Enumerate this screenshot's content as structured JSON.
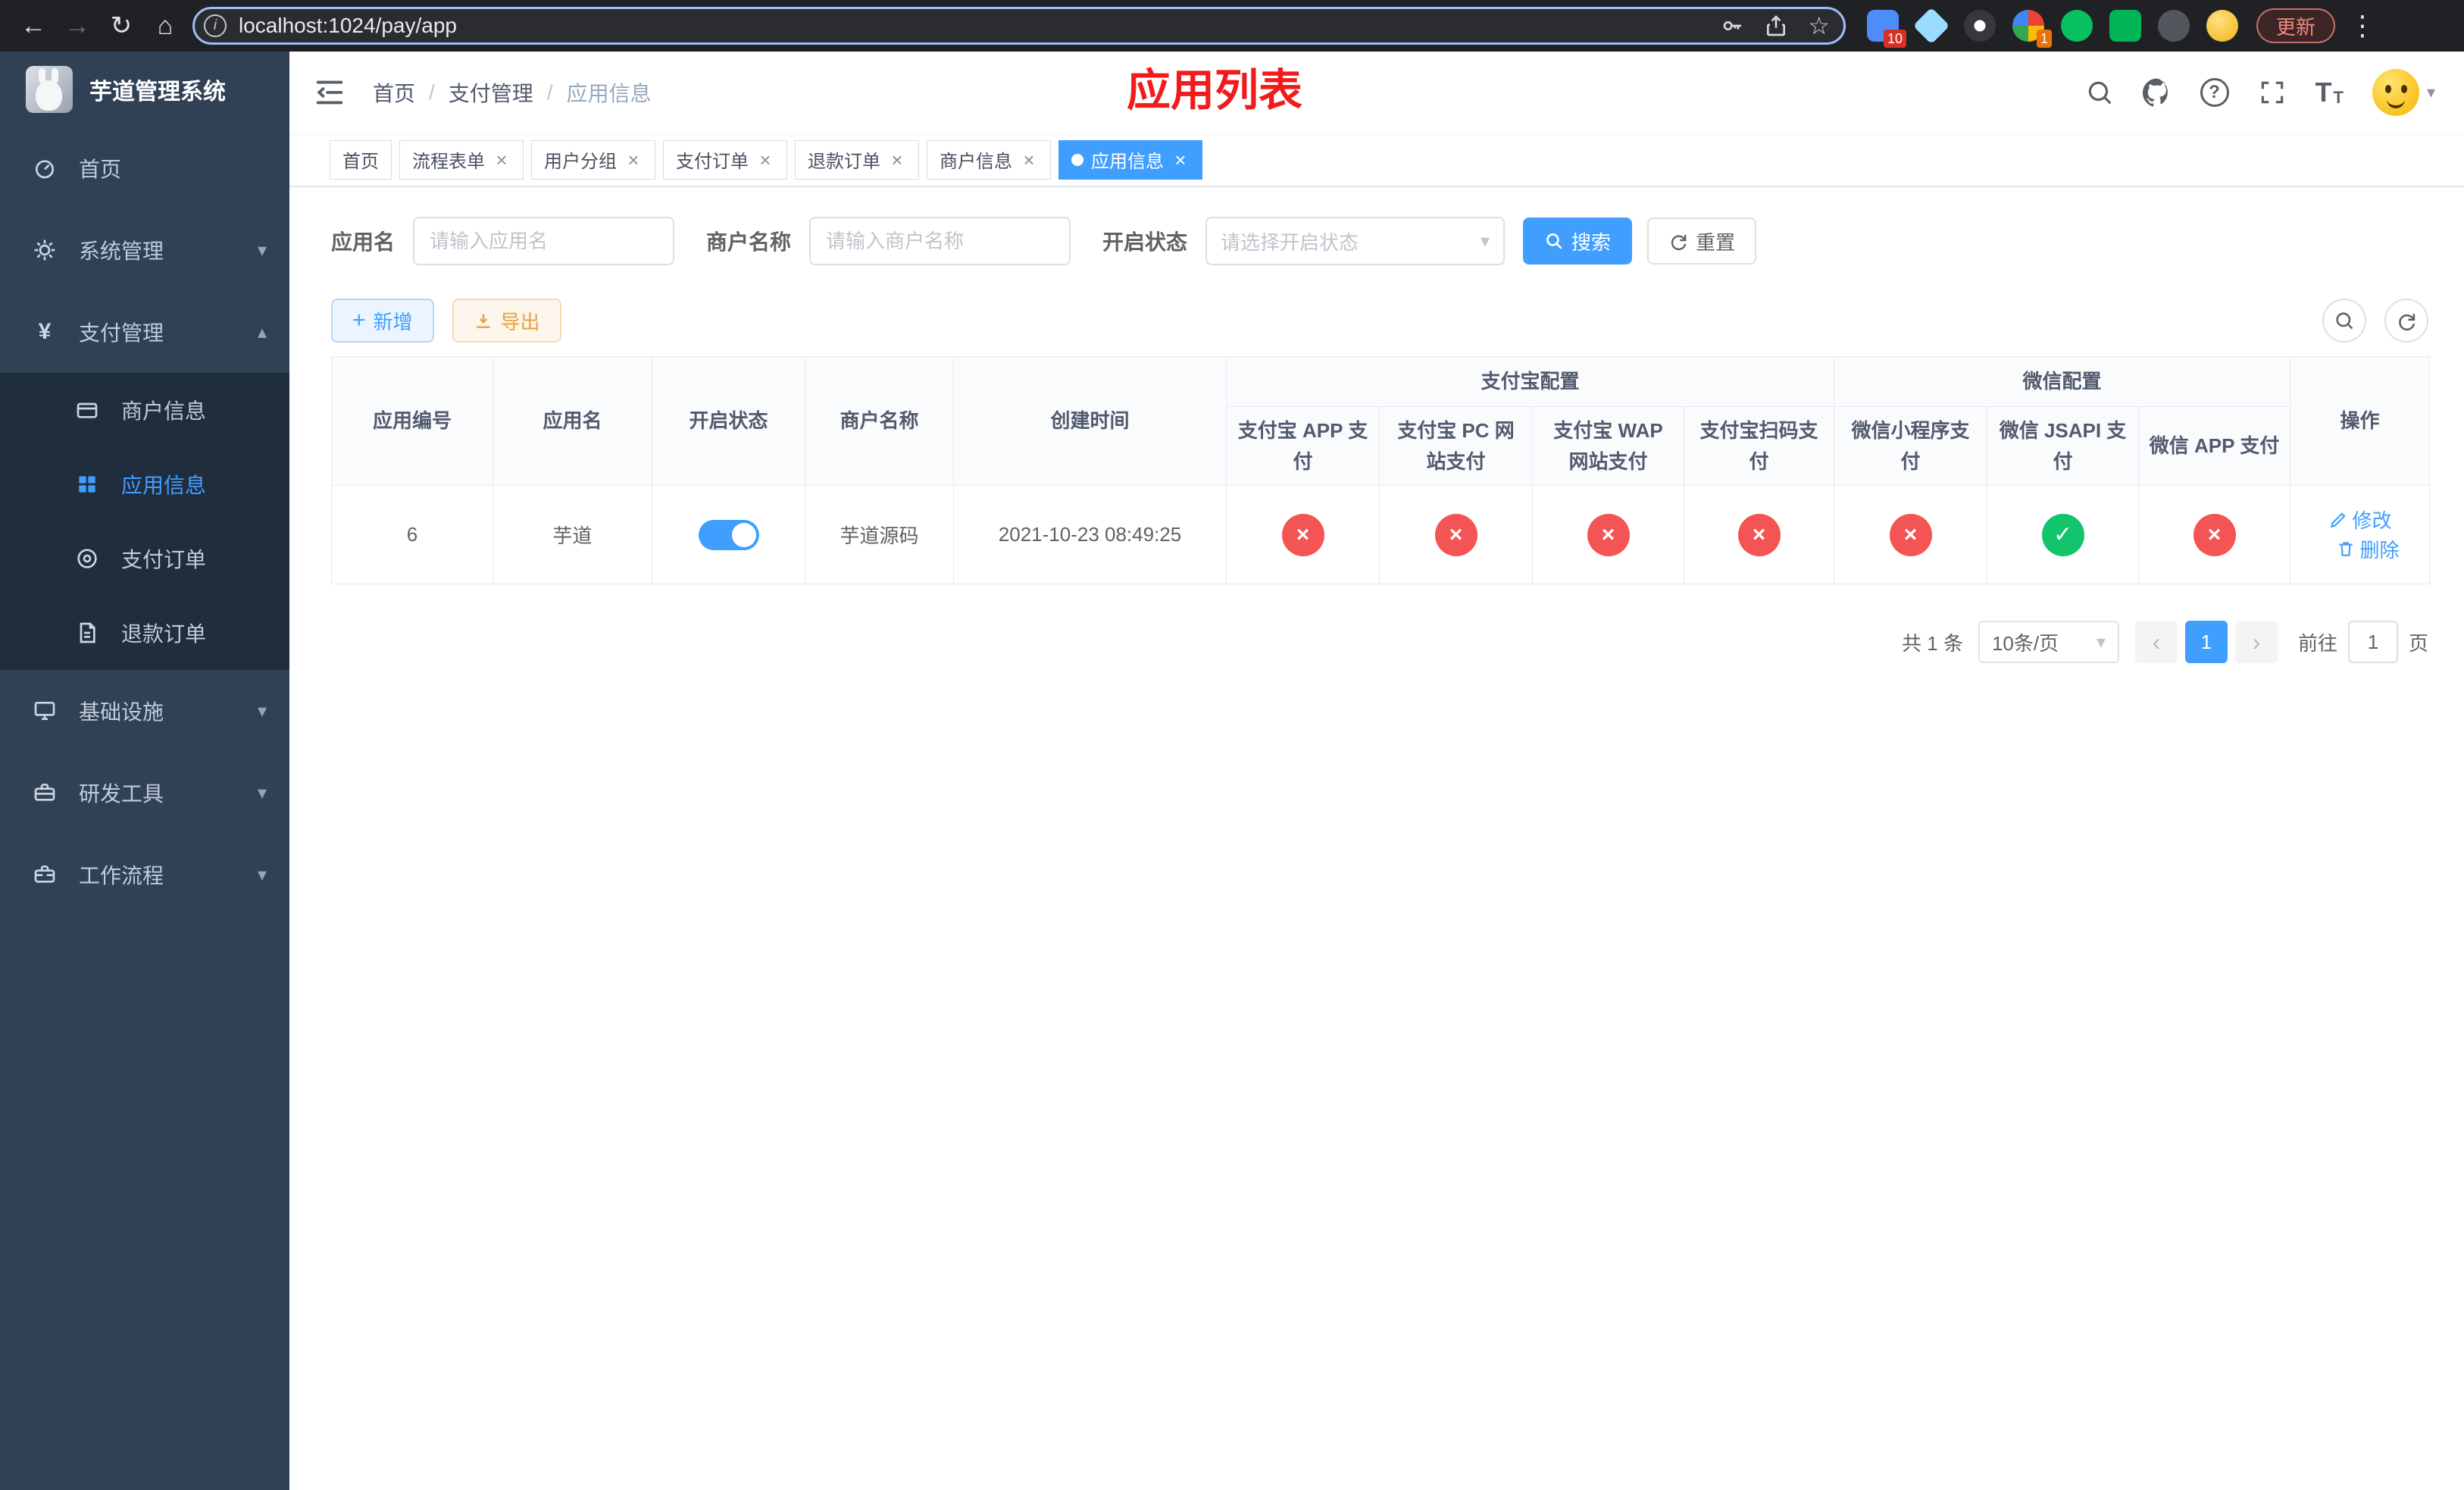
{
  "colors": {
    "primary": "#409eff",
    "success": "#12c56c",
    "danger": "#f45454",
    "warning": "#e6a23c",
    "annotation_red": "#f21b1b",
    "sidebar_bg": "#304156",
    "submenu_bg": "#1f2d3d"
  },
  "icons": {
    "back": "←",
    "forward": "→",
    "reload": "↻",
    "home": "⌂",
    "kebab": "⋮",
    "star": "☆",
    "info": "i",
    "chevron_down": "▾",
    "chevron_up": "▴",
    "close": "×",
    "check": "✓",
    "cross": "×",
    "plus": "+",
    "prev": "‹",
    "next": "›",
    "breadcrumb_sep": "/",
    "help": "?",
    "font_icon": "T"
  },
  "browser": {
    "url": "localhost:1024/pay/app",
    "update_label": "更新",
    "ext_badge_10": "10",
    "ext_badge_1": "1"
  },
  "app": {
    "logo_title": "芋道管理系统",
    "annotation": "应用列表"
  },
  "breadcrumb": [
    "首页",
    "支付管理",
    "应用信息"
  ],
  "sidebar": {
    "items": [
      {
        "label": "首页"
      },
      {
        "label": "系统管理"
      },
      {
        "label": "支付管理"
      },
      {
        "label": "商户信息"
      },
      {
        "label": "应用信息"
      },
      {
        "label": "支付订单"
      },
      {
        "label": "退款订单"
      },
      {
        "label": "基础设施"
      },
      {
        "label": "研发工具"
      },
      {
        "label": "工作流程"
      }
    ]
  },
  "tabs": [
    {
      "label": "首页"
    },
    {
      "label": "流程表单"
    },
    {
      "label": "用户分组"
    },
    {
      "label": "支付订单"
    },
    {
      "label": "退款订单"
    },
    {
      "label": "商户信息"
    },
    {
      "label": "应用信息"
    }
  ],
  "filters": {
    "app_name_label": "应用名",
    "app_name_placeholder": "请输入应用名",
    "merchant_label": "商户名称",
    "merchant_placeholder": "请输入商户名称",
    "status_label": "开启状态",
    "status_placeholder": "请选择开启状态",
    "search_label": "搜索",
    "reset_label": "重置"
  },
  "toolbar": {
    "add_label": "新增",
    "export_label": "导出"
  },
  "table": {
    "groups": {
      "alipay": "支付宝配置",
      "wechat": "微信配置"
    },
    "columns": [
      "应用编号",
      "应用名",
      "开启状态",
      "商户名称",
      "创建时间",
      "支付宝 APP 支付",
      "支付宝 PC 网站支付",
      "支付宝 WAP 网站支付",
      "支付宝扫码支付",
      "微信小程序支付",
      "微信 JSAPI 支付",
      "微信 APP 支付",
      "操作"
    ],
    "rows": [
      {
        "id": "6",
        "name": "芋道",
        "enabled": true,
        "merchant": "芋道源码",
        "created": "2021-10-23 08:49:25",
        "alipay_app": false,
        "alipay_pc": false,
        "alipay_wap": false,
        "alipay_qr": false,
        "wechat_mini": false,
        "wechat_jsapi": true,
        "wechat_app": false
      }
    ],
    "op_edit": "修改",
    "op_delete": "删除"
  },
  "pagination": {
    "total": "共 1 条",
    "page_size": "10条/页",
    "page": "1",
    "goto_label": "前往",
    "goto_value": "1",
    "page_unit": "页"
  }
}
